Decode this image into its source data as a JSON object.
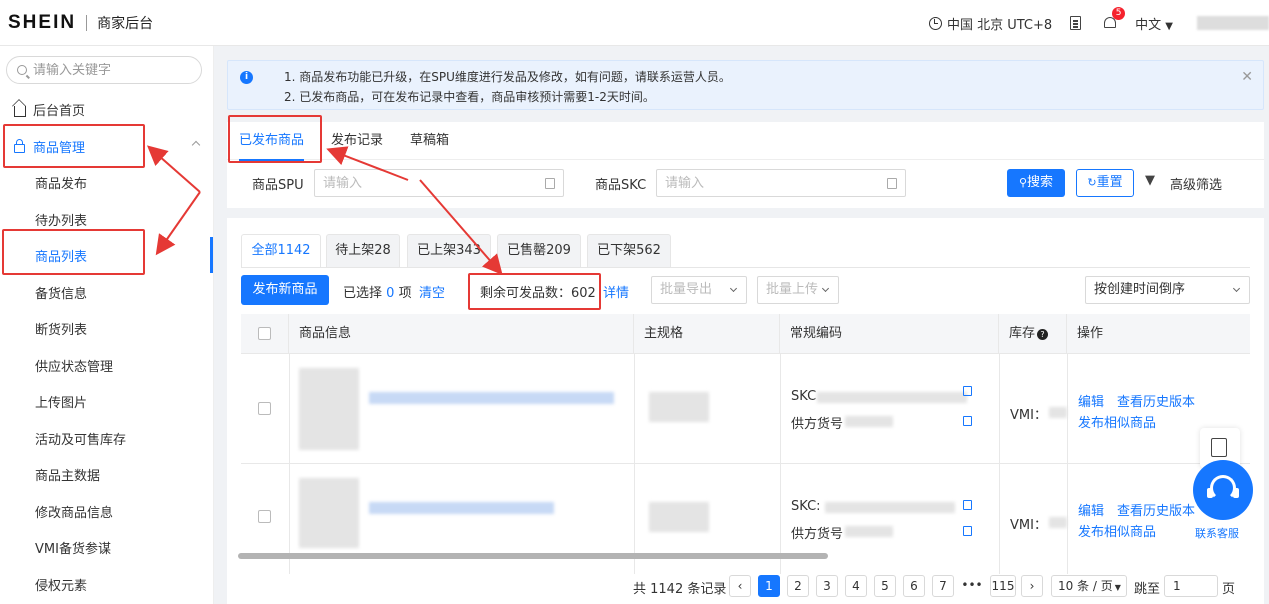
{
  "header": {
    "logo": "SHEIN",
    "app_title": "商家后台",
    "timezone": "中国 北京 UTC+8",
    "notification_count": "5",
    "language": "中文"
  },
  "sidebar": {
    "search_placeholder": "请输入关键字",
    "home": "后台首页",
    "group": "商品管理",
    "items": [
      "商品发布",
      "待办列表",
      "商品列表",
      "备货信息",
      "断货列表",
      "供应状态管理",
      "上传图片",
      "活动及可售库存",
      "商品主数据",
      "修改商品信息",
      "VMI备货参谋",
      "侵权元素"
    ]
  },
  "notice": {
    "line1": "1. 商品发布功能已升级，在SPU维度进行发品及修改，如有问题，请联系运营人员。",
    "line2": "2. 已发布商品，可在发布记录中查看，商品审核预计需要1-2天时间。"
  },
  "tabs": [
    "已发布商品",
    "发布记录",
    "草稿箱"
  ],
  "filters": {
    "spu_label": "商品SPU",
    "spu_placeholder": "请输入",
    "skc_label": "商品SKC",
    "skc_placeholder": "请输入",
    "search_button": "搜索",
    "reset_button": "重置",
    "advanced": "高级筛选"
  },
  "status_tabs": [
    "全部1142",
    "待上架28",
    "已上架343",
    "已售罄209",
    "已下架562"
  ],
  "toolbar": {
    "publish_button": "发布新商品",
    "selected_prefix": "已选择",
    "selected_count": "0",
    "selected_suffix": "项",
    "clear": "清空",
    "remaining": "剩余可发品数：602",
    "details": "详情",
    "batch_export": "批量导出",
    "batch_upload": "批量上传",
    "sort": "按创建时间倒序"
  },
  "table": {
    "columns": [
      "商品信息",
      "主规格",
      "常规编码",
      "库存",
      "操作"
    ],
    "rows": [
      {
        "skc_label": "SKC",
        "supplier_label": "供方货号",
        "stock_label": "VMI：",
        "ops": [
          "编辑",
          "查看历史版本",
          "发布相似商品"
        ]
      },
      {
        "skc_label": "SKC:",
        "supplier_label": "供方货号",
        "stock_label": "VMI：",
        "ops": [
          "编辑",
          "查看历史版本",
          "发布相似商品"
        ]
      }
    ]
  },
  "pagination": {
    "total": "共 1142 条记录",
    "pages": [
      "1",
      "2",
      "3",
      "4",
      "5",
      "6",
      "7",
      "•••",
      "115"
    ],
    "current": "1",
    "page_size": "10 条 / 页",
    "jump_label": "跳至",
    "jump_value": "1",
    "page_suffix": "页"
  },
  "support_label": "联系客服",
  "colors": {
    "accent": "#1677ff",
    "highlight": "#e53935"
  }
}
